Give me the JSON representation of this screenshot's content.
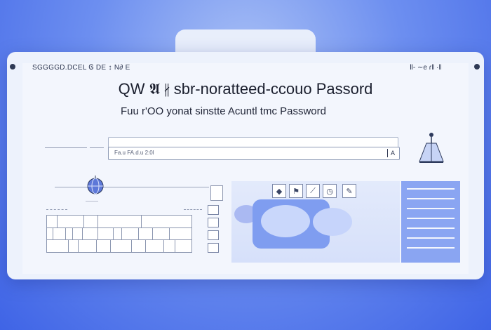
{
  "window": {
    "header_left": "SGGGGD.DCEL Ꮆ DE ↕ N∂ E",
    "header_right": "Ⅱ- ∼e ɾ‖ ·‖"
  },
  "title": "QW 𝕬 ∦ sbr-noratteed-ccouo Passord",
  "subtitle": "Fuu r'OO  yonat sinstte Acuntl tmc Password",
  "login_field": {
    "value": "",
    "placeholder": "Fa.u  FA.d.u  2:0l",
    "icon_label": "A"
  },
  "globe_caption": "———",
  "toolbar_icons": [
    "diamond-icon",
    "flag-icon",
    "slash-icon",
    "clock-icon",
    "edit-icon"
  ],
  "toolbar_glyphs": [
    "◆",
    "⚑",
    "⟋",
    "◷",
    "✎"
  ],
  "colors": {
    "background": "#4f72ea",
    "panel": "#edf2fc",
    "accent": "#7f9df0"
  }
}
